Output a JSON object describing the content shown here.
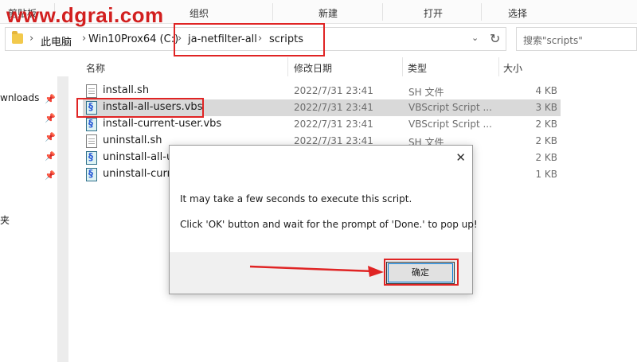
{
  "watermark": "www.dgrai.com",
  "ribbon": {
    "groups": [
      "剪贴板",
      "组织",
      "新建",
      "打开",
      "选择"
    ]
  },
  "address": {
    "crumbs": [
      "此电脑",
      "Win10Prox64 (C:)",
      "ja-netfilter-all",
      "scripts"
    ]
  },
  "search": {
    "placeholder": "搜索\"scripts\""
  },
  "nav": {
    "items": [
      "wnloads",
      "夹"
    ]
  },
  "columns": {
    "name": "名称",
    "date": "修改日期",
    "type": "类型",
    "size": "大小"
  },
  "files": [
    {
      "name": "install.sh",
      "date": "2022/7/31 23:41",
      "type": "SH 文件",
      "size": "4 KB",
      "kind": "sh"
    },
    {
      "name": "install-all-users.vbs",
      "date": "2022/7/31 23:41",
      "type": "VBScript Script ...",
      "size": "3 KB",
      "kind": "vbs"
    },
    {
      "name": "install-current-user.vbs",
      "date": "2022/7/31 23:41",
      "type": "VBScript Script ...",
      "size": "2 KB",
      "kind": "vbs"
    },
    {
      "name": "uninstall.sh",
      "date": "2022/7/31 23:41",
      "type": "SH 文件",
      "size": "2 KB",
      "kind": "sh"
    },
    {
      "name": "uninstall-all-us",
      "date": "",
      "type": "t ...",
      "size": "2 KB",
      "kind": "vbs"
    },
    {
      "name": "uninstall-curren",
      "date": "",
      "type": "t ...",
      "size": "1 KB",
      "kind": "vbs"
    }
  ],
  "dialog": {
    "line1": "It may take a few seconds to execute this script.",
    "line2": "Click 'OK' button and wait for the prompt of 'Done.' to pop up!",
    "ok_label": "确定",
    "close_glyph": "✕"
  },
  "colors": {
    "annotation_red": "#e02424",
    "selected_row": "#d9d9d9",
    "folder_yellow": "#f2c94c"
  }
}
